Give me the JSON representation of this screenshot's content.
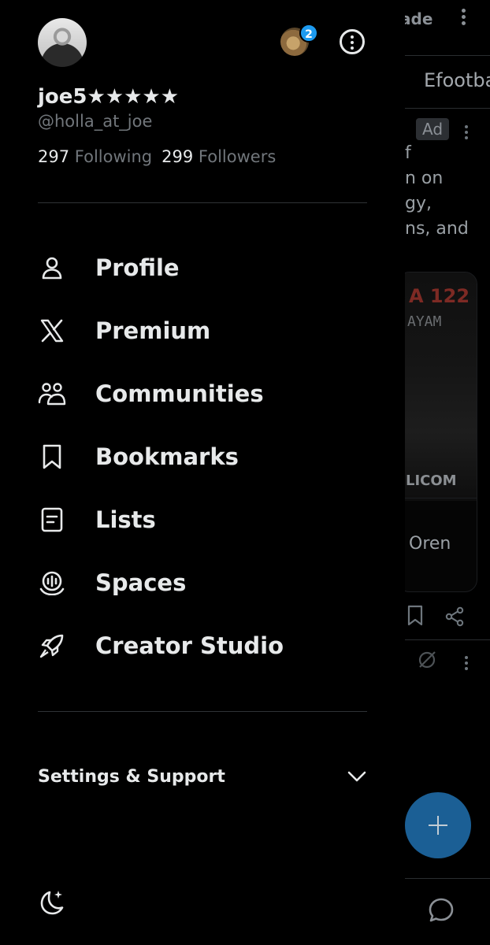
{
  "background": {
    "mode_text": "ade",
    "tab_text": "Efootba",
    "ad_badge": "Ad",
    "ad_lines": [
      "f",
      "n on",
      "gy,",
      "ns, and"
    ],
    "card_red_text": "A 122",
    "card_grey_text": "AYAM",
    "card_logo_text": "LICOM",
    "card_footer_text": "Oren"
  },
  "profile": {
    "display_name": "joe5★★★★★",
    "handle": "@holla_at_joe",
    "following_count": "297",
    "following_label": "Following",
    "followers_count": "299",
    "followers_label": "Followers",
    "notification_badge": "2"
  },
  "nav": {
    "items": [
      {
        "label": "Profile",
        "icon": "person-icon"
      },
      {
        "label": "Premium",
        "icon": "x-logo-icon"
      },
      {
        "label": "Communities",
        "icon": "communities-icon"
      },
      {
        "label": "Bookmarks",
        "icon": "bookmark-icon"
      },
      {
        "label": "Lists",
        "icon": "list-icon"
      },
      {
        "label": "Spaces",
        "icon": "spaces-icon"
      },
      {
        "label": "Creator Studio",
        "icon": "rocket-icon"
      }
    ]
  },
  "settings": {
    "label": "Settings & Support"
  },
  "colors": {
    "background": "#000000",
    "primary_text": "#e7e9ea",
    "secondary_text": "#71767b",
    "accent": "#1d9bf0",
    "divider": "#2f3336"
  }
}
